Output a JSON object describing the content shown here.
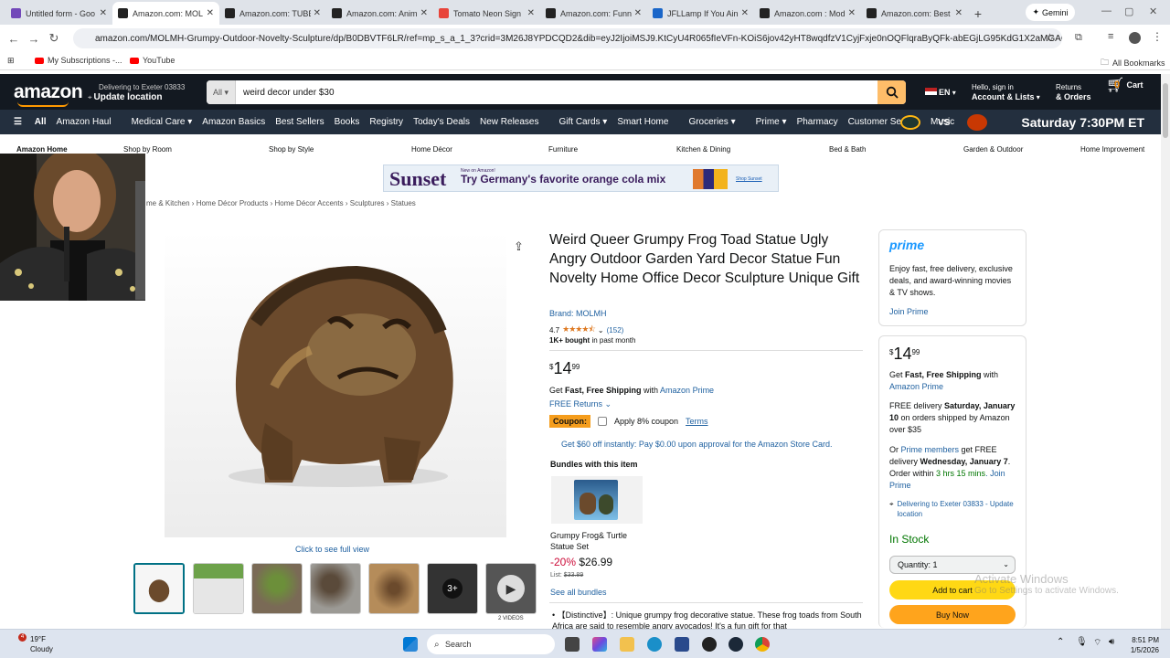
{
  "browser": {
    "tabs": [
      {
        "title": "Untitled form - Goo",
        "color": "#7248b9"
      },
      {
        "title": "Amazon.com: MOL",
        "color": "#222"
      },
      {
        "title": "Amazon.com: TUBB",
        "color": "#222"
      },
      {
        "title": "Amazon.com: Anim",
        "color": "#222"
      },
      {
        "title": "Tomato Neon Sign",
        "color": "#e8443a"
      },
      {
        "title": "Amazon.com: Funn",
        "color": "#222"
      },
      {
        "title": "JFLLamp If You Ain",
        "color": "#1a66c9"
      },
      {
        "title": "Amazon.com : Mod",
        "color": "#222"
      },
      {
        "title": "Amazon.com: Best",
        "color": "#222"
      }
    ],
    "gemini_label": "Gemini",
    "url": "amazon.com/MOLMH-Grumpy-Outdoor-Novelty-Sculpture/dp/B0DBVTF6LR/ref=mp_s_a_1_3?crid=3M26J8YPDCQD2&dib=eyJ2IjoiMSJ9.KtCyU4R065fIeVFn-KOiS6jov42yHT8wqdfzV1CyjFxje0nOQFlqraByQFk-abEGjLG95KdG1X2aMGAG4mGmkxqm3w...",
    "bookmarks": {
      "subs": "My Subscriptions -...",
      "yt": "YouTube",
      "all": "All Bookmarks"
    }
  },
  "amazon": {
    "logo": "amazon",
    "deliver_line1": "Delivering to Exeter 03833",
    "deliver_line2": "Update location",
    "search_category": "All",
    "search_value": "weird decor under $30",
    "lang": "EN",
    "account_line1": "Hello, sign in",
    "account_line2": "Account & Lists",
    "returns_line1": "Returns",
    "returns_line2": "& Orders",
    "cart_count": "0",
    "cart_label": "Cart",
    "nav": [
      "All",
      "Amazon Haul",
      "Medical Care",
      "Amazon Basics",
      "Best Sellers",
      "Books",
      "Registry",
      "Today's Deals",
      "New Releases",
      "Gift Cards",
      "Smart Home",
      "Groceries",
      "Prime",
      "Pharmacy",
      "Customer Service",
      "Music"
    ],
    "nav_promo_vs": "VS",
    "nav_promo": "Saturday 7:30PM ET",
    "subnav": [
      "Amazon Home",
      "Shop by Room",
      "Shop by Style",
      "Home Décor",
      "Furniture",
      "Kitchen & Dining",
      "Bed & Bath",
      "Garden & Outdoor",
      "Home Improvement"
    ],
    "banner": {
      "brand": "Sunset",
      "small": "New on Amazon!",
      "text": "Try Germany's favorite orange cola mix",
      "shop": "Shop Sunset"
    },
    "breadcrumbs": "me & Kitchen › Home Décor Products › Home Décor Accents › Sculptures › Statues"
  },
  "product": {
    "title": "Weird Queer Grumpy Frog Toad Statue Ugly Angry Outdoor Garden Yard Decor Statue Fun Novelty Home Office Decor Sculpture Unique Gift",
    "brand": "Brand: MOLMH",
    "rating": "4.7",
    "rating_value": 4.7,
    "reviews": "(152)",
    "bought_bold": "1K+ bought",
    "bought_rest": " in past month",
    "price_symbol": "$",
    "price_whole": "14",
    "price_cents": "99",
    "ship_prefix": "Get ",
    "ship_bold": "Fast, Free Shipping",
    "ship_with": " with ",
    "ship_link": "Amazon Prime",
    "returns": "FREE Returns",
    "coupon_tag": "Coupon:",
    "coupon_text": "Apply 8% coupon",
    "coupon_terms": "Terms",
    "store_card": "Get $60 off instantly: Pay $0.00 upon approval for the Amazon Store Card.",
    "bundles_heading": "Bundles with this item",
    "bundle_name": "Grumpy Frog& Turtle Statue Set",
    "bundle_discount": "-20%",
    "bundle_price": "$26.99",
    "bundle_list_label": "List: ",
    "bundle_list_price": "$33.89",
    "see_bundles": "See all bundles",
    "bullet": "【Distinctive】: Unique grumpy frog decorative statue. These frog toads from South Africa are said to resemble angry avocados! It's a fun gift for that",
    "full_view": "Click to see full view",
    "thumb_more": "3+",
    "videos_label": "2 VIDEOS"
  },
  "prime_box": {
    "logo": "prime",
    "desc": "Enjoy fast, free delivery, exclusive deals, and award-winning movies & TV shows.",
    "join": "Join Prime"
  },
  "buy_box": {
    "price_symbol": "$",
    "price_whole": "14",
    "price_cents": "99",
    "ship_prefix": "Get ",
    "ship_bold": "Fast, Free Shipping",
    "ship_with": " with ",
    "ship_link": "Amazon Prime",
    "free_delivery_prefix": "FREE delivery ",
    "free_delivery_bold": "Saturday, January 10",
    "free_delivery_rest": " on orders shipped by Amazon over $35",
    "or": "Or ",
    "prime_members": "Prime members",
    "fastest_mid": " get FREE delivery ",
    "fastest_bold": "Wednesday, January 7",
    "order_within": ". Order within ",
    "countdown": "3 hrs 15 mins",
    "join_prime": ". Join Prime",
    "delivering": "Delivering to Exeter 03833 - Update location",
    "in_stock": "In Stock",
    "quantity": "Quantity: 1",
    "add_to_cart": "Add to cart",
    "buy_now": "Buy Now"
  },
  "windows": {
    "activate_title": "Activate Windows",
    "activate_sub": "Go to Settings to activate Windows.",
    "weather_temp": "19°F",
    "weather_desc": "Cloudy",
    "weather_badge": "4",
    "search": "Search",
    "time": "8:51 PM",
    "date": "1/5/2026"
  }
}
